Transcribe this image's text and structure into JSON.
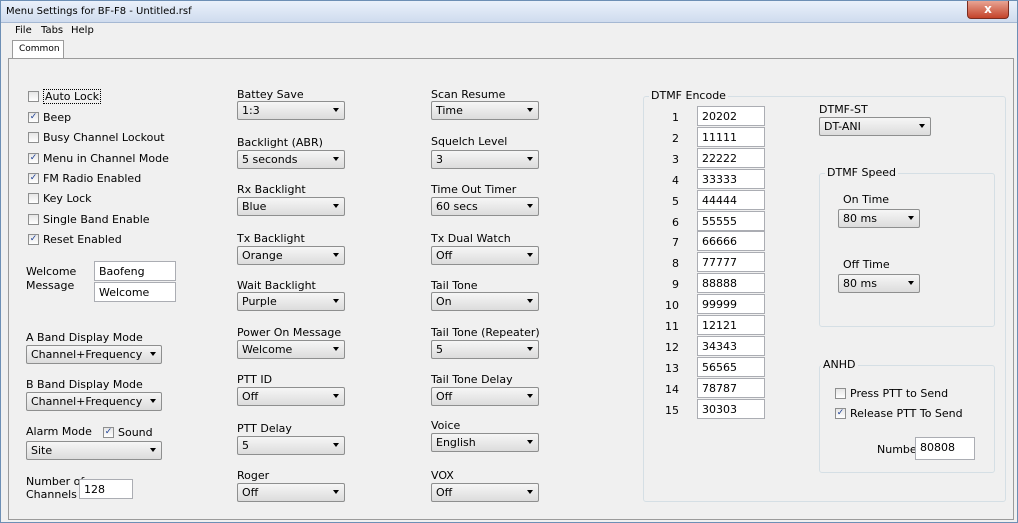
{
  "window": {
    "title": "Menu Settings for BF-F8 - Untitled.rsf",
    "close": "x"
  },
  "menu": {
    "file": "File",
    "tabs": "Tabs",
    "help": "Help"
  },
  "tab": {
    "label": "Common"
  },
  "col1": {
    "auto_lock": {
      "label": "Auto Lock",
      "checked": false
    },
    "beep": {
      "label": "Beep",
      "checked": true
    },
    "busy_lockout": {
      "label": "Busy Channel Lockout",
      "checked": false
    },
    "menu_channel": {
      "label": "Menu in Channel Mode",
      "checked": true
    },
    "fm_radio": {
      "label": "FM Radio Enabled",
      "checked": true
    },
    "key_lock": {
      "label": "Key Lock",
      "checked": false
    },
    "single_band": {
      "label": "Single Band Enable",
      "checked": false
    },
    "reset": {
      "label": "Reset Enabled",
      "checked": true
    },
    "welcome_label1": "Welcome",
    "welcome_label2": "Message",
    "welcome_line1": "Baofeng",
    "welcome_line2": "Welcome",
    "a_band_label": "A Band Display Mode",
    "a_band_value": "Channel+Frequency",
    "b_band_label": "B Band Display Mode",
    "b_band_value": "Channel+Frequency",
    "alarm_label": "Alarm Mode",
    "sound_label": "Sound",
    "sound_checked": true,
    "alarm_value": "Site",
    "channels_label1": "Number of",
    "channels_label2": "Channels",
    "channels_value": "128"
  },
  "col2": {
    "battery_save": {
      "label": "Battey Save",
      "value": "1:3"
    },
    "backlight": {
      "label": "Backlight (ABR)",
      "value": "5 seconds"
    },
    "rx_backlight": {
      "label": "Rx Backlight",
      "value": "Blue"
    },
    "tx_backlight": {
      "label": "Tx Backlight",
      "value": "Orange"
    },
    "wait_backlight": {
      "label": "Wait Backlight",
      "value": "Purple"
    },
    "power_on": {
      "label": "Power On Message",
      "value": "Welcome"
    },
    "ptt_id": {
      "label": "PTT ID",
      "value": "Off"
    },
    "ptt_delay": {
      "label": "PTT Delay",
      "value": "5"
    },
    "roger": {
      "label": "Roger",
      "value": "Off"
    }
  },
  "col3": {
    "scan_resume": {
      "label": "Scan Resume",
      "value": "Time"
    },
    "squelch": {
      "label": "Squelch Level",
      "value": "3"
    },
    "timeout": {
      "label": "Time Out Timer",
      "value": "60 secs"
    },
    "dual_watch": {
      "label": "Tx Dual Watch",
      "value": "Off"
    },
    "tail_tone": {
      "label": "Tail Tone",
      "value": "On"
    },
    "tail_tone_rep": {
      "label": "Tail Tone (Repeater)",
      "value": "5"
    },
    "tail_delay": {
      "label": "Tail Tone Delay",
      "value": "Off"
    },
    "voice": {
      "label": "Voice",
      "value": "English"
    },
    "vox": {
      "label": "VOX",
      "value": "Off"
    }
  },
  "dtmf": {
    "title": "DTMF Encode",
    "rows": [
      {
        "n": "1",
        "v": "20202"
      },
      {
        "n": "2",
        "v": "11111"
      },
      {
        "n": "3",
        "v": "22222"
      },
      {
        "n": "4",
        "v": "33333"
      },
      {
        "n": "5",
        "v": "44444"
      },
      {
        "n": "6",
        "v": "55555"
      },
      {
        "n": "7",
        "v": "66666"
      },
      {
        "n": "8",
        "v": "77777"
      },
      {
        "n": "9",
        "v": "88888"
      },
      {
        "n": "10",
        "v": "99999"
      },
      {
        "n": "11",
        "v": "12121"
      },
      {
        "n": "12",
        "v": "34343"
      },
      {
        "n": "13",
        "v": "56565"
      },
      {
        "n": "14",
        "v": "78787"
      },
      {
        "n": "15",
        "v": "30303"
      }
    ],
    "st_label": "DTMF-ST",
    "st_value": "DT-ANI",
    "speed_title": "DTMF Speed",
    "on_time_label": "On Time",
    "on_time_value": "80 ms",
    "off_time_label": "Off Time",
    "off_time_value": "80 ms",
    "anhd_title": "ANHD",
    "press_ptt": {
      "label": "Press PTT to Send",
      "checked": false
    },
    "release_ptt": {
      "label": "Release PTT To Send",
      "checked": true
    },
    "number_label": "Number",
    "number_value": "80808"
  }
}
